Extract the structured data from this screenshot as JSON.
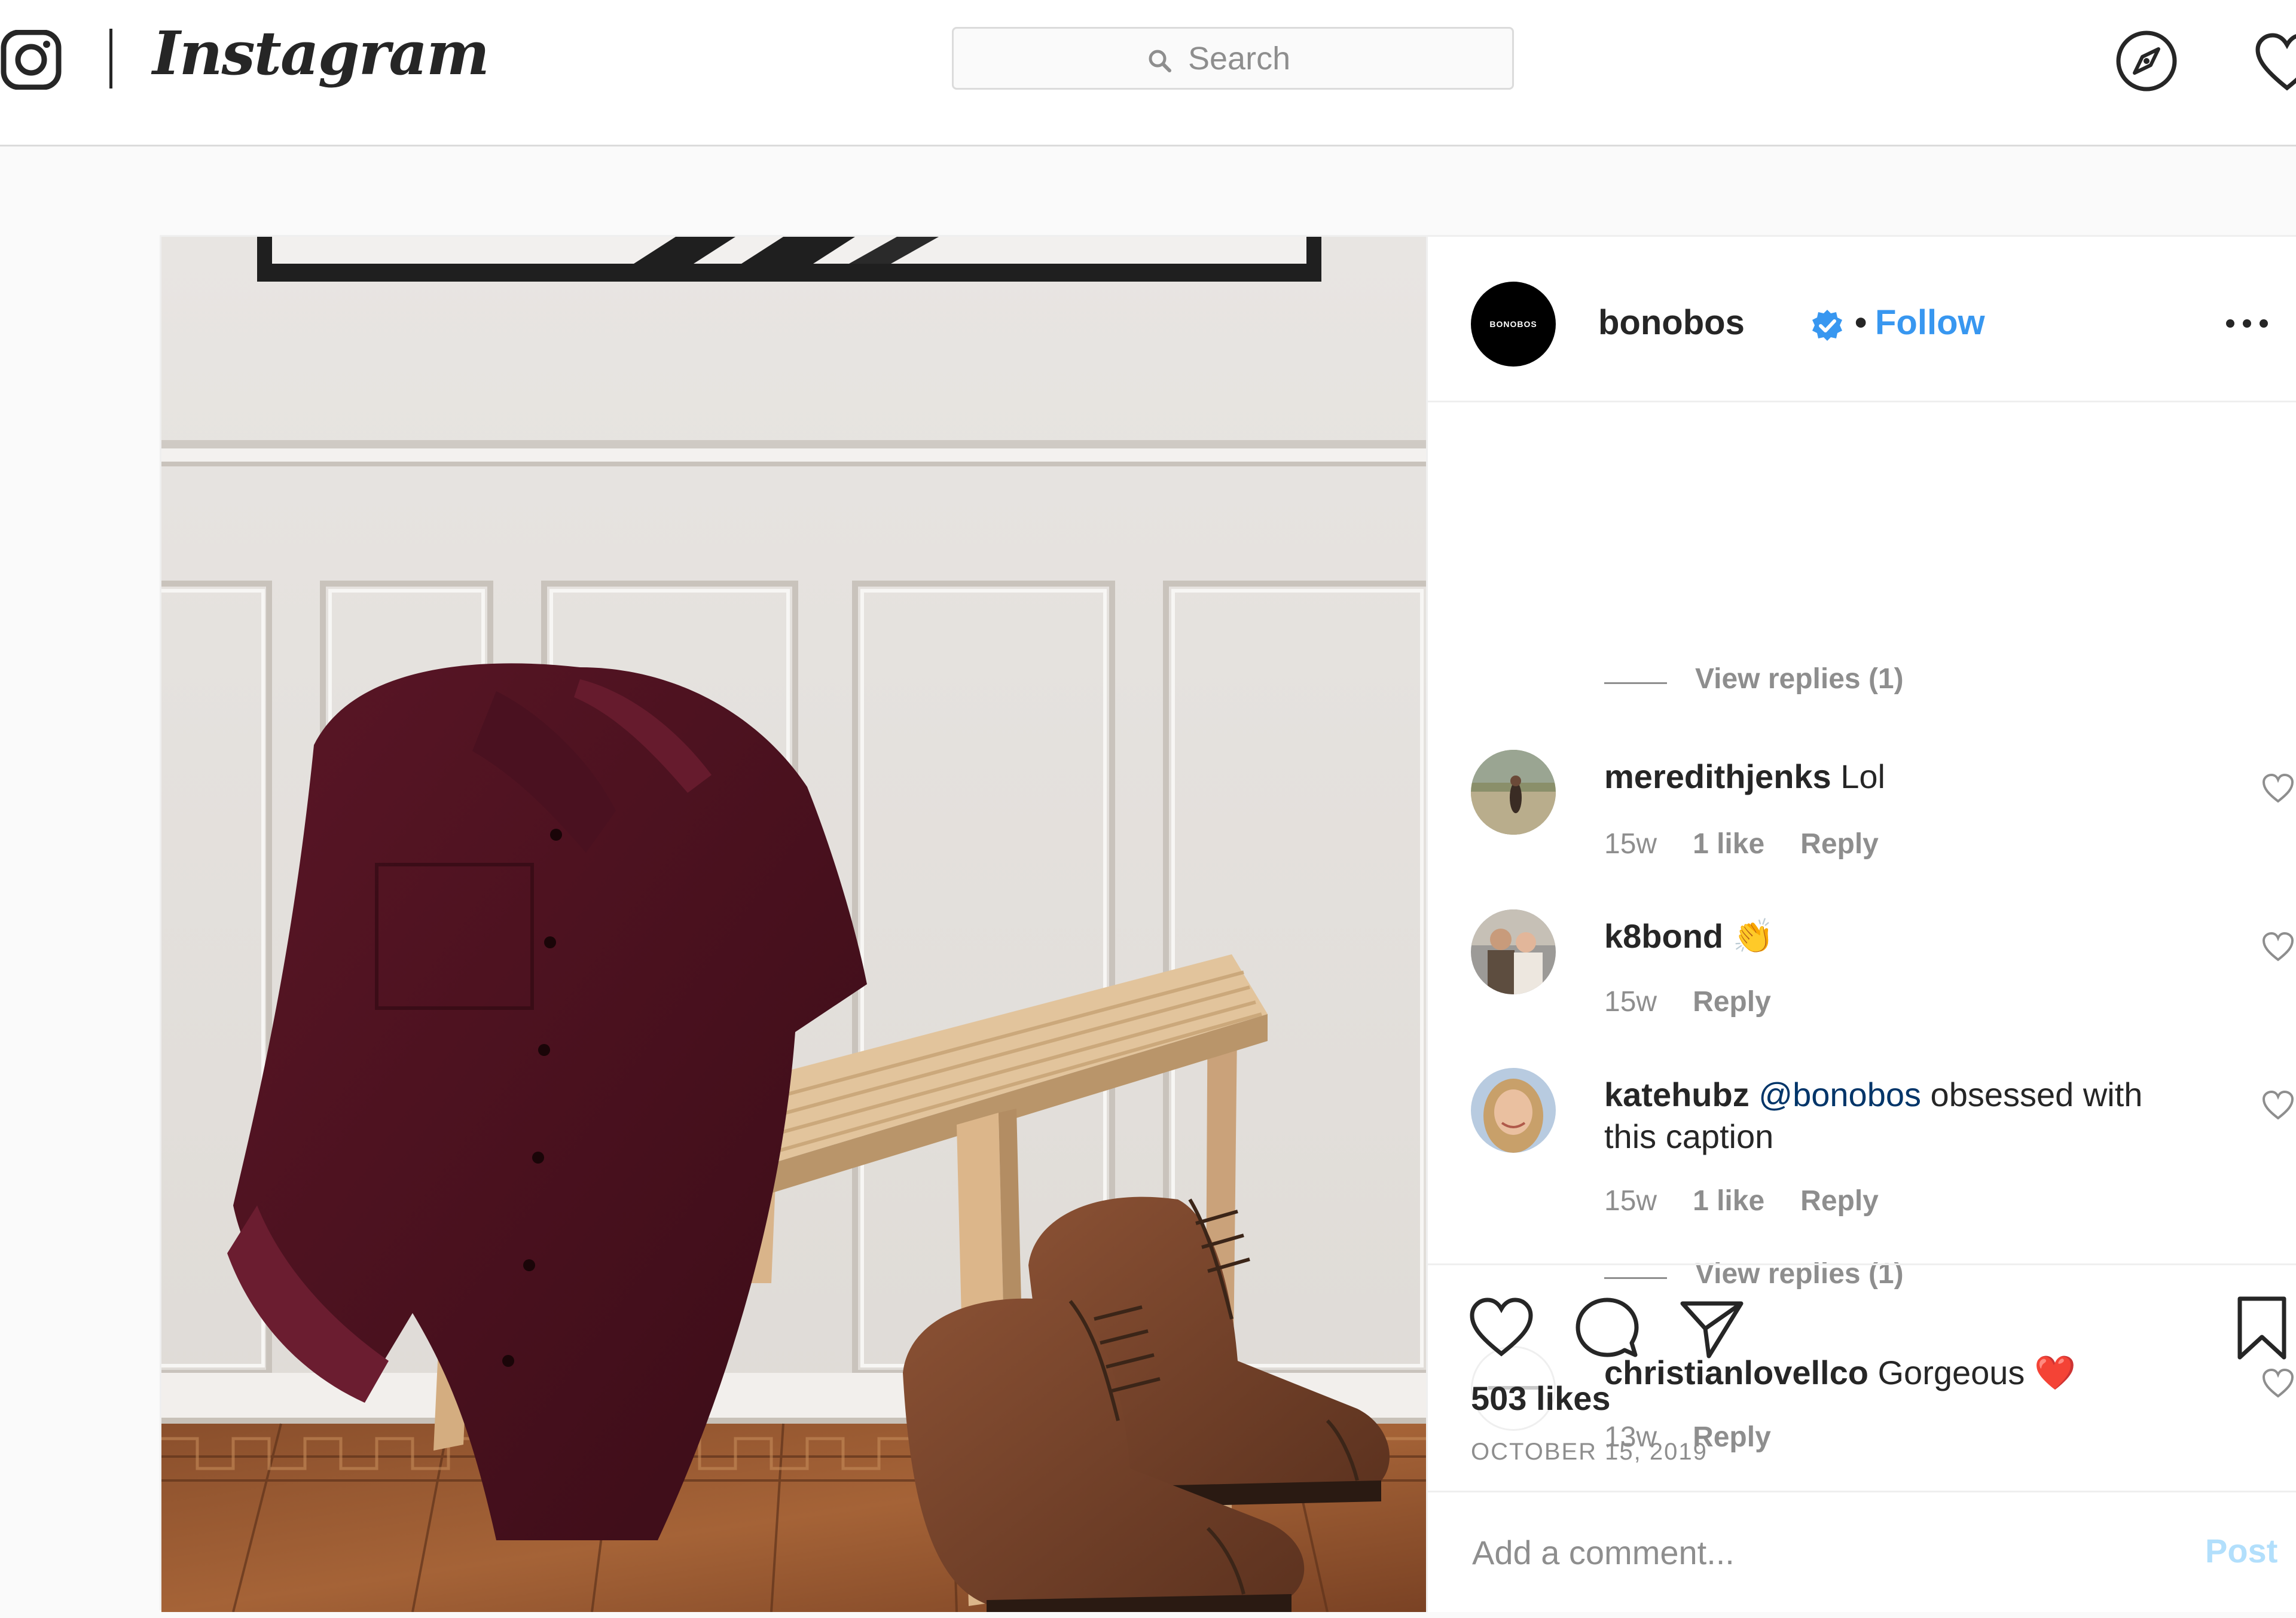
{
  "header": {
    "wordmark": "Instagram",
    "search_placeholder": "Search"
  },
  "post": {
    "author": "bonobos",
    "author_avatar_text": "BONOBOS",
    "separator": "•",
    "follow_label": "Follow",
    "comments": [
      {
        "type": "view_replies",
        "label": "View replies (1)"
      },
      {
        "type": "comment",
        "user": "meredithjenks",
        "text": "Lol",
        "time": "15w",
        "likes": "1 like",
        "reply": "Reply"
      },
      {
        "type": "comment",
        "user": "k8bond",
        "text": "👏",
        "time": "15w",
        "reply": "Reply"
      },
      {
        "type": "comment",
        "user": "katehubz",
        "mention": "@bonobos",
        "text": "obsessed with this caption",
        "time": "15w",
        "likes": "1 like",
        "reply": "Reply"
      },
      {
        "type": "view_replies",
        "label": "View replies (1)"
      },
      {
        "type": "comment",
        "user": "christianlovellco",
        "text": "Gorgeous",
        "emoji": "❤️",
        "time": "13w",
        "reply": "Reply"
      }
    ],
    "likes": "503 likes",
    "date": "OCTOBER 15, 2019",
    "comment_placeholder": "Add a comment...",
    "post_label": "Post"
  },
  "colors": {
    "link_blue": "#3897f0",
    "verified_blue": "#3897f0",
    "post_disabled": "#b2dffc",
    "muted": "#8e8e8e"
  }
}
